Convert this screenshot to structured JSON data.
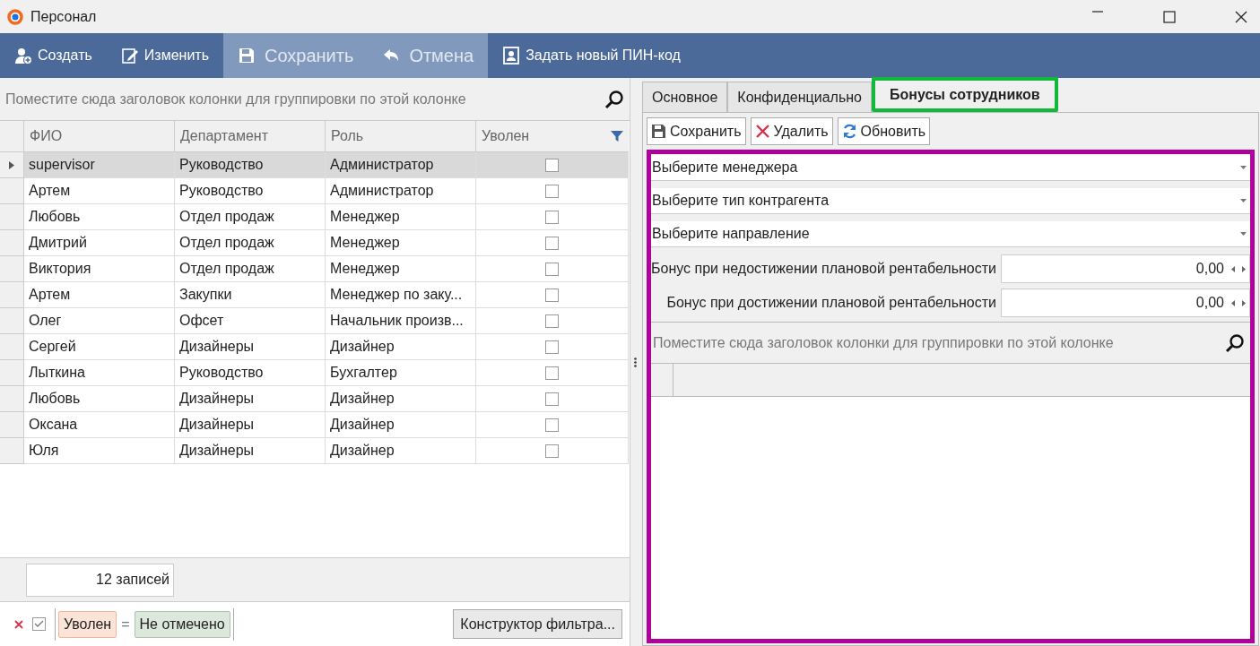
{
  "window": {
    "title": "Персонал"
  },
  "toolbar": [
    {
      "label": "Создать",
      "disabled": false
    },
    {
      "label": "Изменить",
      "disabled": false
    },
    {
      "label": "Сохранить",
      "disabled": true
    },
    {
      "label": "Отмена",
      "disabled": true
    },
    {
      "label": "Задать новый ПИН-код",
      "disabled": false
    }
  ],
  "staff_grid": {
    "group_panel": {
      "placeholder": "Поместите сюда заголовок колонки для группировки по этой колонке"
    },
    "columns": [
      "ФИО",
      "Департамент",
      "Роль",
      "Уволен"
    ],
    "rows": [
      {
        "name": "supervisor",
        "department": "Руководство",
        "role": "Администратор",
        "fired": false,
        "selected": true
      },
      {
        "name": "Артем",
        "department": "Руководство",
        "role": "Администратор",
        "fired": false,
        "selected": false
      },
      {
        "name": "Любовь",
        "department": "Отдел продаж",
        "role": "Менеджер",
        "fired": false,
        "selected": false
      },
      {
        "name": "Дмитрий",
        "department": "Отдел продаж",
        "role": "Менеджер",
        "fired": false,
        "selected": false
      },
      {
        "name": "Виктория",
        "department": "Отдел продаж",
        "role": "Менеджер",
        "fired": false,
        "selected": false
      },
      {
        "name": "Артем",
        "department": "Закупки",
        "role": "Менеджер по заку...",
        "fired": false,
        "selected": false
      },
      {
        "name": "Олег",
        "department": "Офсет",
        "role": "Начальник произв...",
        "fired": false,
        "selected": false
      },
      {
        "name": "Сергей",
        "department": "Дизайнеры",
        "role": "Дизайнер",
        "fired": false,
        "selected": false
      },
      {
        "name": "Лыткина",
        "department": "Руководство",
        "role": "Бухгалтер",
        "fired": false,
        "selected": false
      },
      {
        "name": "Любовь",
        "department": "Дизайнеры",
        "role": "Дизайнер",
        "fired": false,
        "selected": false
      },
      {
        "name": "Оксана",
        "department": "Дизайнеры",
        "role": "Дизайнер",
        "fired": false,
        "selected": false
      },
      {
        "name": "Юля",
        "department": "Дизайнеры",
        "role": "Дизайнер",
        "fired": false,
        "selected": false
      }
    ],
    "record_count": "12 записей",
    "filter": {
      "enabled": true,
      "field": "Уволен",
      "operator": "=",
      "value": "Не отмечено",
      "builder_button": "Конструктор фильтра..."
    }
  },
  "detail": {
    "tabs": [
      {
        "label": "Основное",
        "selected": false
      },
      {
        "label": "Конфиденциально",
        "selected": false
      },
      {
        "label": "Бонусы сотрудников",
        "selected": true
      }
    ],
    "buttons": [
      "Сохранить",
      "Удалить",
      "Обновить"
    ],
    "dropdowns": [
      {
        "placeholder": "Выберите менеджера"
      },
      {
        "placeholder": "Выберите тип контрагента"
      },
      {
        "placeholder": "Выберите направление"
      }
    ],
    "bonus_fields": [
      {
        "label": "Бонус при недостижении плановой рентабельности",
        "value": "0,00"
      },
      {
        "label": "Бонус при достижении плановой рентабельности",
        "value": "0,00"
      }
    ],
    "group_panel": {
      "placeholder": "Поместите сюда заголовок колонки для группировки по этой колонке"
    }
  }
}
